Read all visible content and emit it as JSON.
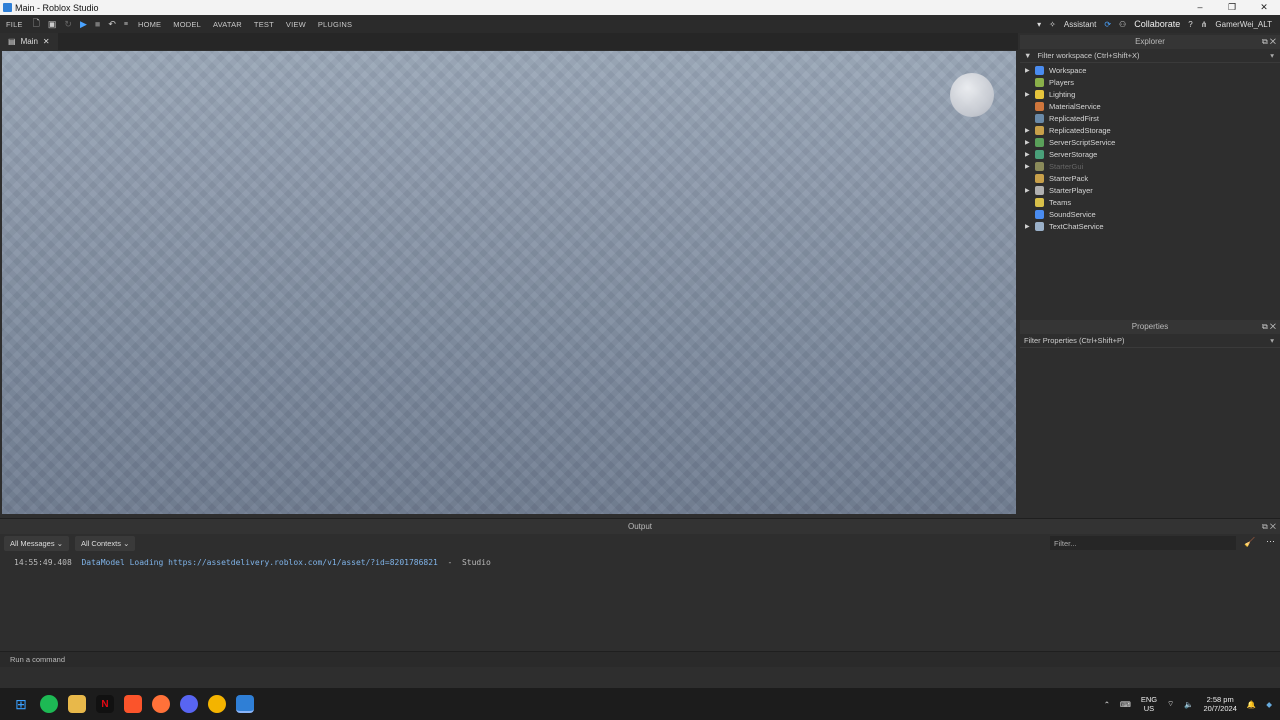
{
  "window": {
    "title": "Main - Roblox Studio",
    "controls": [
      "–",
      "❐",
      "✕"
    ]
  },
  "menubar": {
    "file": "FILE",
    "tabs": [
      "HOME",
      "MODEL",
      "AVATAR",
      "TEST",
      "VIEW",
      "PLUGINS"
    ],
    "assistant": "Assistant",
    "collaborate": "Collaborate",
    "user": "GamerWei_ALT"
  },
  "document_tab": {
    "label": "Main",
    "close": "✕"
  },
  "explorer": {
    "title": "Explorer",
    "filter_placeholder": "Filter workspace (Ctrl+Shift+X)",
    "items": [
      {
        "label": "Workspace",
        "expandable": true,
        "color": "#4a8cf0"
      },
      {
        "label": "Players",
        "expandable": false,
        "color": "#8ab04a"
      },
      {
        "label": "Lighting",
        "expandable": true,
        "color": "#e6c43c"
      },
      {
        "label": "MaterialService",
        "expandable": false,
        "color": "#d0763c"
      },
      {
        "label": "ReplicatedFirst",
        "expandable": false,
        "color": "#6a8aa8"
      },
      {
        "label": "ReplicatedStorage",
        "expandable": true,
        "color": "#c8a04a"
      },
      {
        "label": "ServerScriptService",
        "expandable": true,
        "color": "#5aa05a"
      },
      {
        "label": "ServerStorage",
        "expandable": true,
        "color": "#4aa07a"
      },
      {
        "label": "StarterGui",
        "expandable": true,
        "color": "#8a8a5a",
        "dim": true
      },
      {
        "label": "StarterPack",
        "expandable": false,
        "color": "#c8a04a"
      },
      {
        "label": "StarterPlayer",
        "expandable": true,
        "color": "#b0b0b0"
      },
      {
        "label": "Teams",
        "expandable": false,
        "color": "#d8c04a"
      },
      {
        "label": "SoundService",
        "expandable": false,
        "color": "#4a8cf0"
      },
      {
        "label": "TextChatService",
        "expandable": true,
        "color": "#9ab0c8"
      }
    ]
  },
  "properties": {
    "title": "Properties",
    "filter_placeholder": "Filter Properties (Ctrl+Shift+P)"
  },
  "output": {
    "title": "Output",
    "messages_filter": "All Messages",
    "contexts_filter": "All Contexts",
    "filter_placeholder": "Filter...",
    "log": {
      "time": "14:55:49.408",
      "message": "DataModel Loading https://assetdelivery.roblox.com/v1/asset/?id=8201786821",
      "sep": "-",
      "source": "Studio"
    }
  },
  "command_bar": {
    "placeholder": "Run a command"
  },
  "taskbar": {
    "lang_top": "ENG",
    "lang_bottom": "US",
    "time": "2:58 pm",
    "date": "20/7/2024"
  }
}
